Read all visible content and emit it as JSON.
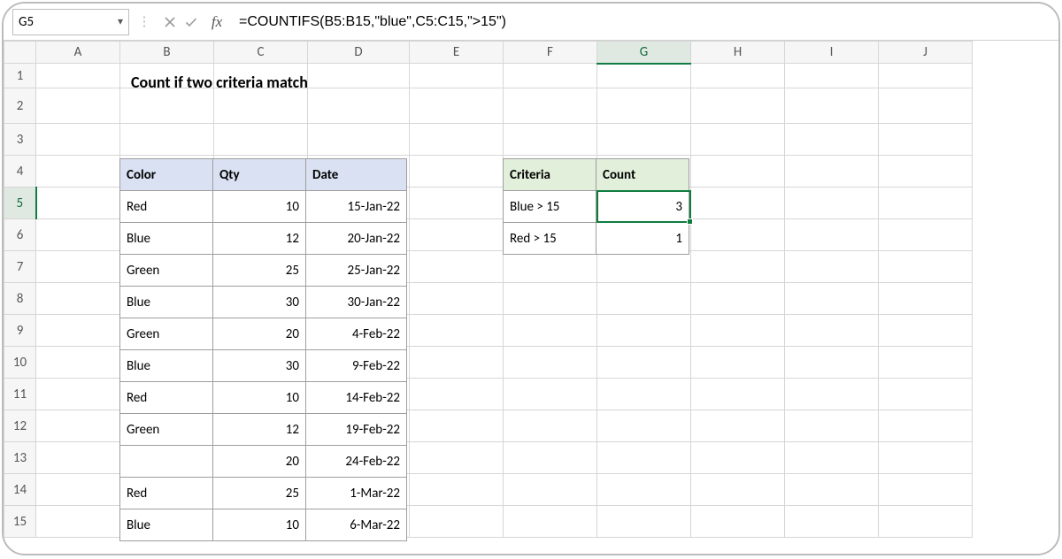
{
  "namebox": {
    "ref": "G5"
  },
  "fx": {
    "label": "fx"
  },
  "formula": "=COUNTIFS(B5:B15,\"blue\",C5:C15,\">15\")",
  "title": "Count if two criteria match",
  "columns": [
    "A",
    "B",
    "C",
    "D",
    "E",
    "F",
    "G",
    "H",
    "I",
    "J"
  ],
  "rows": [
    "1",
    "2",
    "3",
    "4",
    "5",
    "6",
    "7",
    "8",
    "9",
    "10",
    "11",
    "12",
    "13",
    "14",
    "15"
  ],
  "table1": {
    "headers": {
      "color": "Color",
      "qty": "Qty",
      "date": "Date"
    },
    "rows": [
      {
        "color": "Red",
        "qty": "10",
        "date": "15-Jan-22"
      },
      {
        "color": "Blue",
        "qty": "12",
        "date": "20-Jan-22"
      },
      {
        "color": "Green",
        "qty": "25",
        "date": "25-Jan-22"
      },
      {
        "color": "Blue",
        "qty": "30",
        "date": "30-Jan-22"
      },
      {
        "color": "Green",
        "qty": "20",
        "date": "4-Feb-22"
      },
      {
        "color": "Blue",
        "qty": "30",
        "date": "9-Feb-22"
      },
      {
        "color": "Red",
        "qty": "10",
        "date": "14-Feb-22"
      },
      {
        "color": "Green",
        "qty": "12",
        "date": "19-Feb-22"
      },
      {
        "color": "",
        "qty": "20",
        "date": "24-Feb-22"
      },
      {
        "color": "Red",
        "qty": "25",
        "date": "1-Mar-22"
      },
      {
        "color": "Blue",
        "qty": "10",
        "date": "6-Mar-22"
      }
    ]
  },
  "table2": {
    "headers": {
      "criteria": "Criteria",
      "count": "Count"
    },
    "rows": [
      {
        "criteria": "Blue > 15",
        "count": "3"
      },
      {
        "criteria": "Red > 15",
        "count": "1"
      }
    ]
  },
  "active_cell": "G5"
}
